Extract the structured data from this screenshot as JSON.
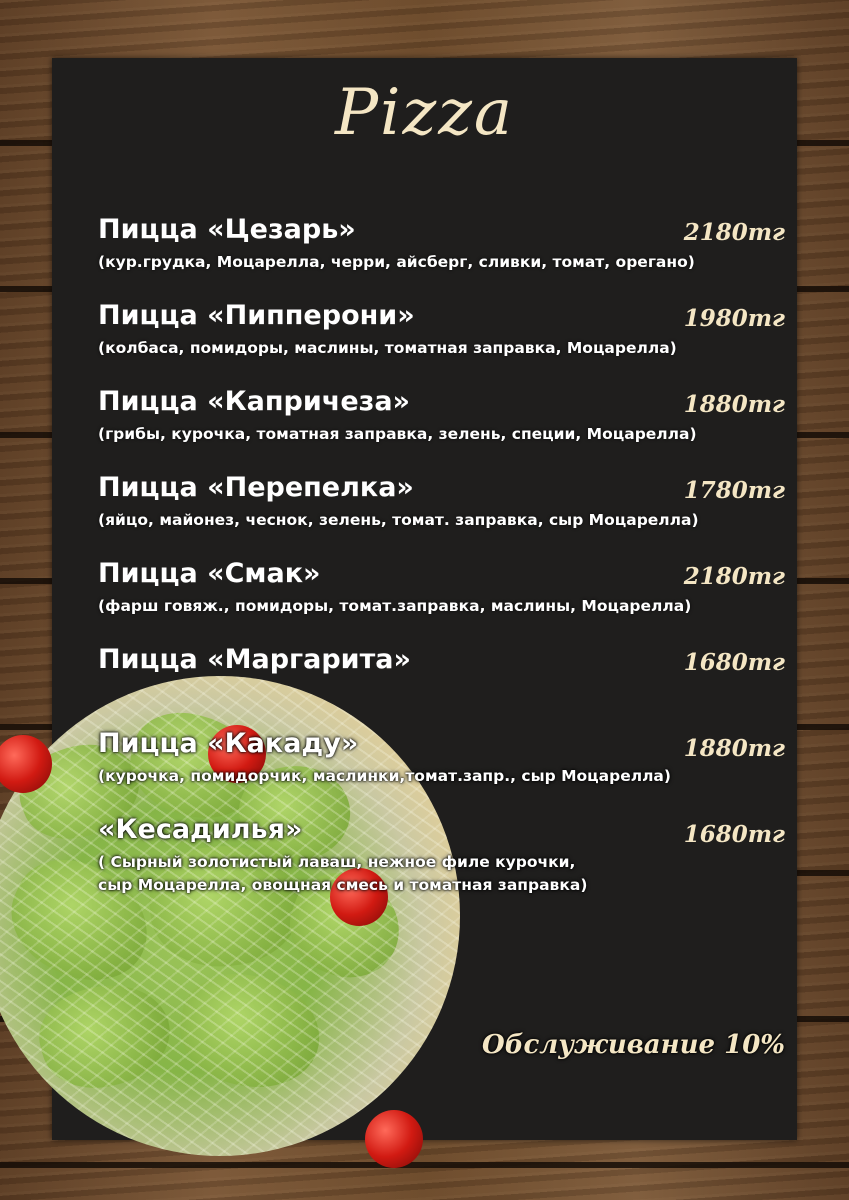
{
  "menu": {
    "title": "Pizza",
    "items": [
      {
        "name": "Пицца «Цезарь»",
        "price": "2180тг",
        "desc": "(кур.грудка, Моцарелла, черри, айсберг, сливки, томат, орегано)"
      },
      {
        "name": "Пицца «Пипперони»",
        "price": "1980тг",
        "desc": "(колбаса, помидоры, маслины, томатная заправка, Моцарелла)"
      },
      {
        "name": "Пицца «Капричеза»",
        "price": "1880тг",
        "desc": "(грибы, курочка, томатная заправка, зелень, специи, Моцарелла)"
      },
      {
        "name": "Пицца «Перепелка»",
        "price": "1780тг",
        "desc": "(яйцо, майонез, чеснок, зелень, томат. заправка, сыр Моцарелла)"
      },
      {
        "name": "Пицца «Смак»",
        "price": "2180тг",
        "desc": "(фарш говяж., помидоры, томат.заправка, маслины, Моцарелла)"
      },
      {
        "name": "Пицца «Маргарита»",
        "price": "1680тг"
      },
      {
        "name": "Пицца «Какаду»",
        "price": "1880тг",
        "desc": "(курочка, помидорчик,  маслинки,томат.запр., сыр Моцарелла)"
      },
      {
        "name": "«Кесадилья»",
        "price": "1680тг",
        "desc_lines": [
          "( Сырный золотистый лаваш, нежное филе курочки,",
          "сыр Моцарелла, овощная смесь и томатная заправка)"
        ]
      }
    ],
    "service": "Обслуживание 10%"
  },
  "colors": {
    "panel": "#1f1e1d",
    "accent": "#f4e6c4",
    "text": "#ffffff"
  }
}
